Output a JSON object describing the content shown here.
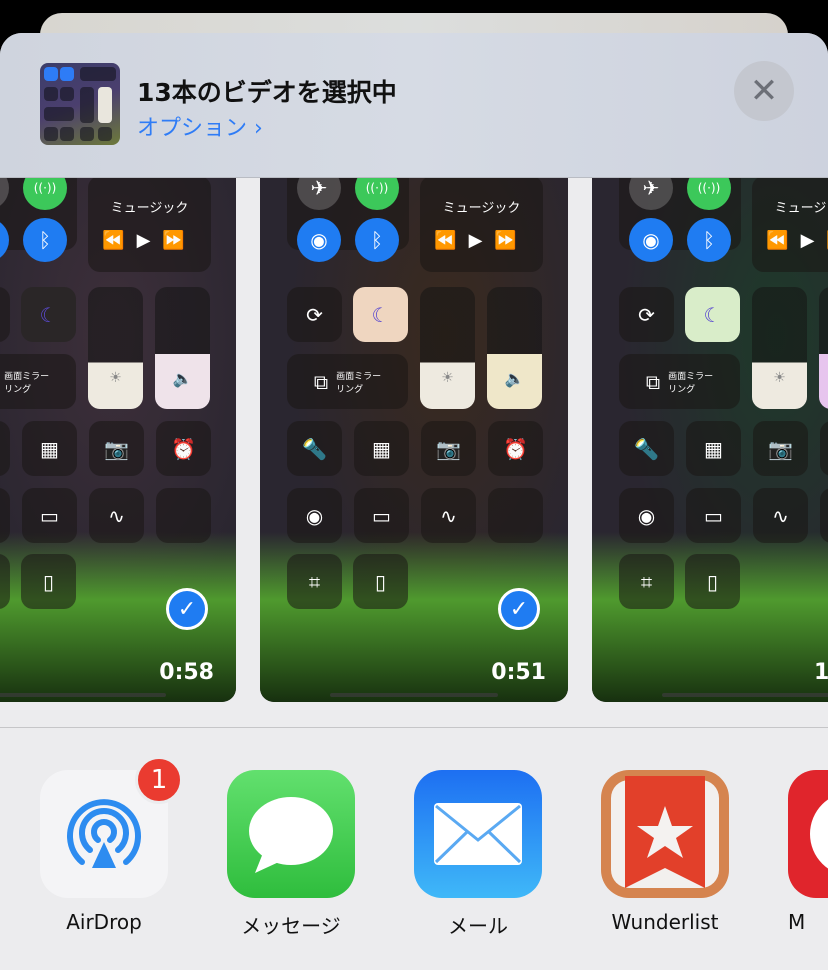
{
  "header": {
    "title": "13本のビデオを選択中",
    "options_label": "オプション ›",
    "close_icon": "close-icon"
  },
  "control_center": {
    "music_label": "ミュージック",
    "mirroring_label": "画面ミラー\nリング"
  },
  "videos": [
    {
      "duration": "0:58",
      "selected": true,
      "tint": "#3d2f3a",
      "volume_color": "#efe3ea",
      "dnd_color": "#2a2627"
    },
    {
      "duration": "0:51",
      "selected": true,
      "tint": "#3a2a1e",
      "volume_color": "#efe7c9",
      "dnd_color": "#efd6c0"
    },
    {
      "duration": "1",
      "selected": true,
      "tint": "#1e3a2a",
      "volume_color": "#e7c5ee",
      "dnd_color": "#d9edc9"
    }
  ],
  "apps": [
    {
      "label": "AirDrop",
      "icon": "airdrop-icon",
      "badge": "1"
    },
    {
      "label": "メッセージ",
      "icon": "messages-icon"
    },
    {
      "label": "メール",
      "icon": "mail-icon"
    },
    {
      "label": "Wunderlist",
      "icon": "wunderlist-icon"
    },
    {
      "label": "M",
      "icon": "app-icon"
    }
  ],
  "colors": {
    "accent": "#2f7cf6",
    "badge": "#ea3b30",
    "check": "#1f7cf2"
  }
}
